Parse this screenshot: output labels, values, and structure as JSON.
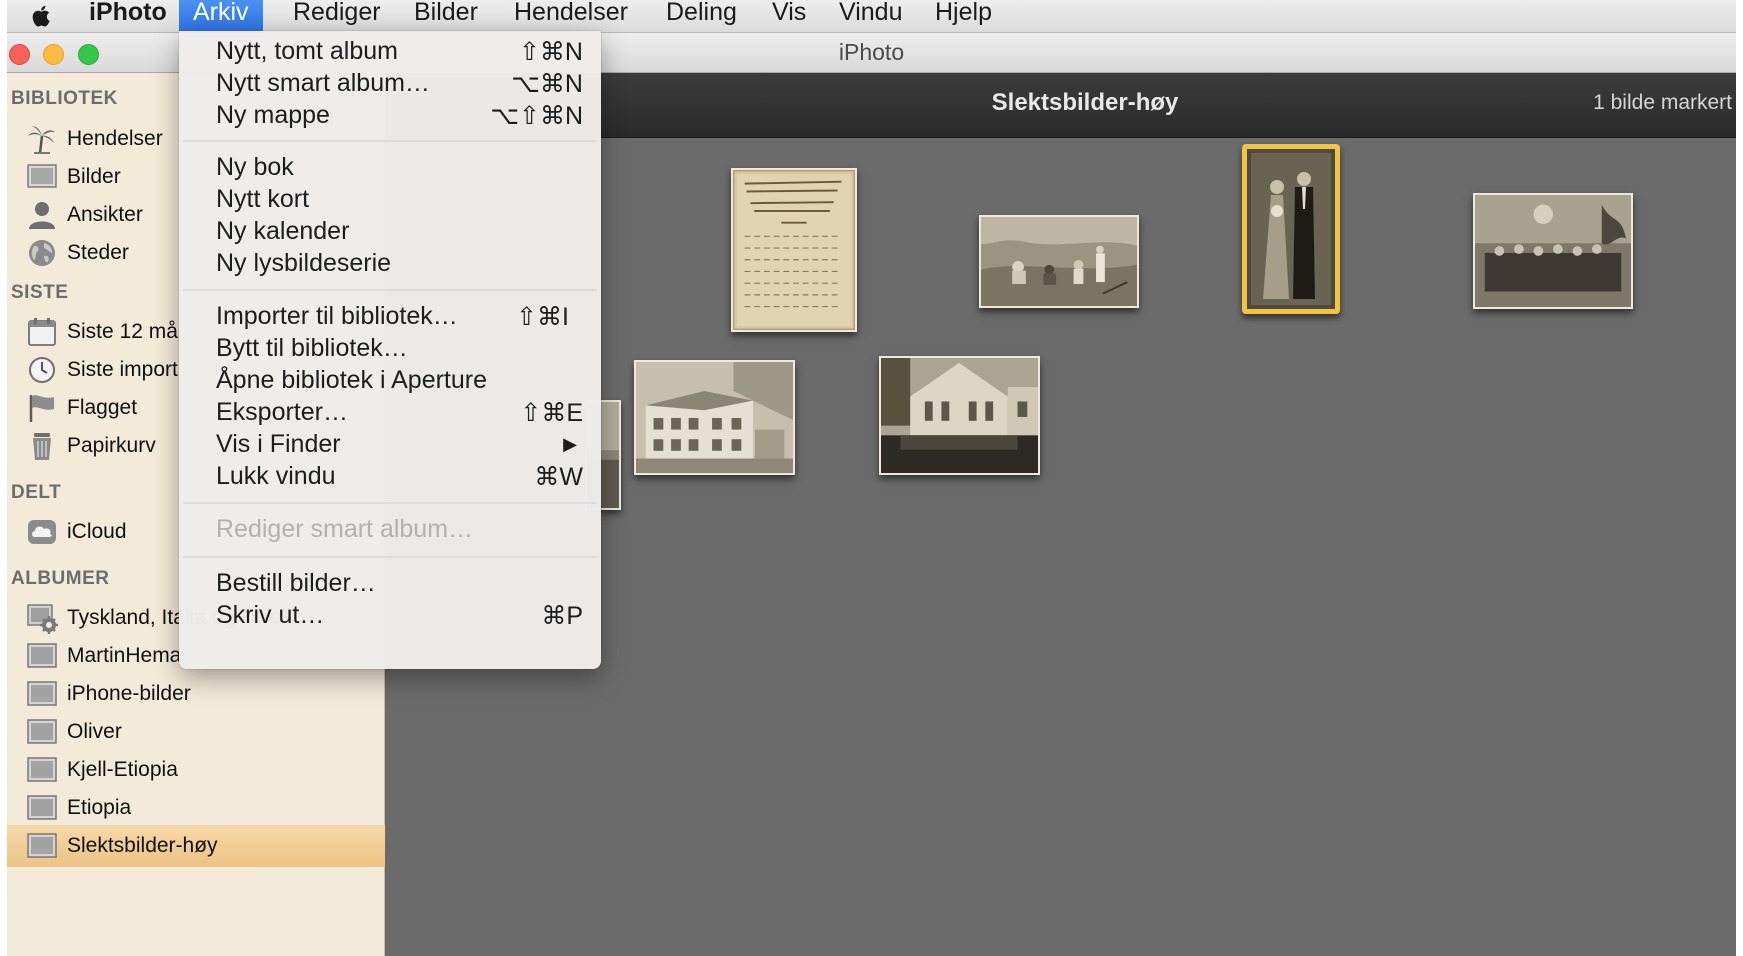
{
  "menubar": {
    "app_name": "iPhoto",
    "items": [
      "Arkiv",
      "Rediger",
      "Bilder",
      "Hendelser",
      "Deling",
      "Vis",
      "Vindu",
      "Hjelp"
    ]
  },
  "window": {
    "title": "iPhoto"
  },
  "sidebar": {
    "sections": {
      "bibliotek": "BIBLIOTEK",
      "siste": "SISTE",
      "delt": "DELT",
      "albumer": "ALBUMER"
    },
    "bibliotek_items": [
      {
        "label": "Hendelser",
        "icon": "palm-tree-icon"
      },
      {
        "label": "Bilder",
        "icon": "photos-icon"
      },
      {
        "label": "Ansikter",
        "icon": "person-icon"
      },
      {
        "label": "Steder",
        "icon": "globe-icon"
      }
    ],
    "siste_items": [
      {
        "label": "Siste 12 må",
        "icon": "calendar-icon"
      },
      {
        "label": "Siste import",
        "icon": "clock-icon"
      },
      {
        "label": "Flagget",
        "icon": "flag-icon"
      },
      {
        "label": "Papirkurv",
        "icon": "trash-icon"
      }
    ],
    "delt_items": [
      {
        "label": "iCloud",
        "icon": "cloud-icon"
      }
    ],
    "album_items": [
      {
        "label": "Tyskland, Italia og flere…",
        "icon": "smart-album-gear-icon"
      },
      {
        "label": "MartinHema",
        "icon": "album-icon"
      },
      {
        "label": "iPhone-bilder",
        "icon": "album-icon"
      },
      {
        "label": "Oliver",
        "icon": "album-icon"
      },
      {
        "label": "Kjell-Etiopia",
        "icon": "album-icon"
      },
      {
        "label": "Etiopia",
        "icon": "album-icon"
      },
      {
        "label": "Slektsbilder-høy",
        "icon": "album-icon",
        "selected": true
      }
    ]
  },
  "content": {
    "album_title": "Slektsbilder-høy",
    "selection_status": "1 bilde markert"
  },
  "arkiv_menu": {
    "groups": [
      [
        {
          "label": "Nytt, tomt album",
          "shortcut": "⇧⌘N"
        },
        {
          "label": "Nytt smart album…",
          "shortcut": "⌥⌘N"
        },
        {
          "label": "Ny mappe",
          "shortcut": "⌥⇧⌘N"
        }
      ],
      [
        {
          "label": "Ny bok",
          "shortcut": ""
        },
        {
          "label": "Nytt kort",
          "shortcut": ""
        },
        {
          "label": "Ny kalender",
          "shortcut": ""
        },
        {
          "label": "Ny lysbildeserie",
          "shortcut": ""
        }
      ],
      [
        {
          "label": "Importer til bibliotek…",
          "shortcut": "⇧⌘I"
        },
        {
          "label": "Bytt til bibliotek…",
          "shortcut": ""
        },
        {
          "label": "Åpne bibliotek i Aperture",
          "shortcut": ""
        },
        {
          "label": "Eksporter…",
          "shortcut": "⇧⌘E"
        },
        {
          "label": "Vis i Finder",
          "shortcut": "▶"
        },
        {
          "label": "Lukk vindu",
          "shortcut": "⌘W"
        }
      ],
      [
        {
          "label": "Rediger smart album…",
          "shortcut": "",
          "disabled": true
        }
      ],
      [
        {
          "label": "Bestill bilder…",
          "shortcut": ""
        },
        {
          "label": "Skriv ut…",
          "shortcut": "⌘P"
        }
      ]
    ]
  }
}
